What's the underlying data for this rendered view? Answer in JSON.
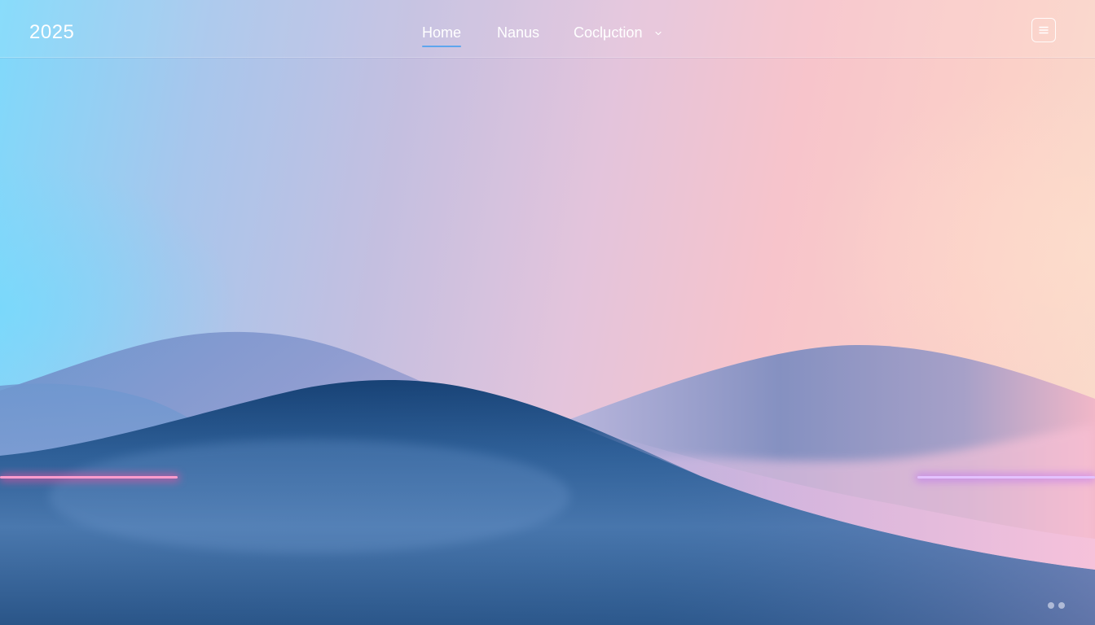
{
  "brand": {
    "title": "2025"
  },
  "nav": {
    "items": [
      {
        "label": "Home",
        "active": true
      },
      {
        "label": "Nanus",
        "active": false
      },
      {
        "label": "Coclμction",
        "active": false,
        "has_dropdown": true
      }
    ]
  },
  "menu_button": {
    "icon": "hamburger-menu-icon"
  },
  "pagination": {
    "dots": 2
  },
  "colors": {
    "accent": "#5ea6ee",
    "neon_left": "#ff4fa0",
    "neon_right": "#b86cf2"
  }
}
